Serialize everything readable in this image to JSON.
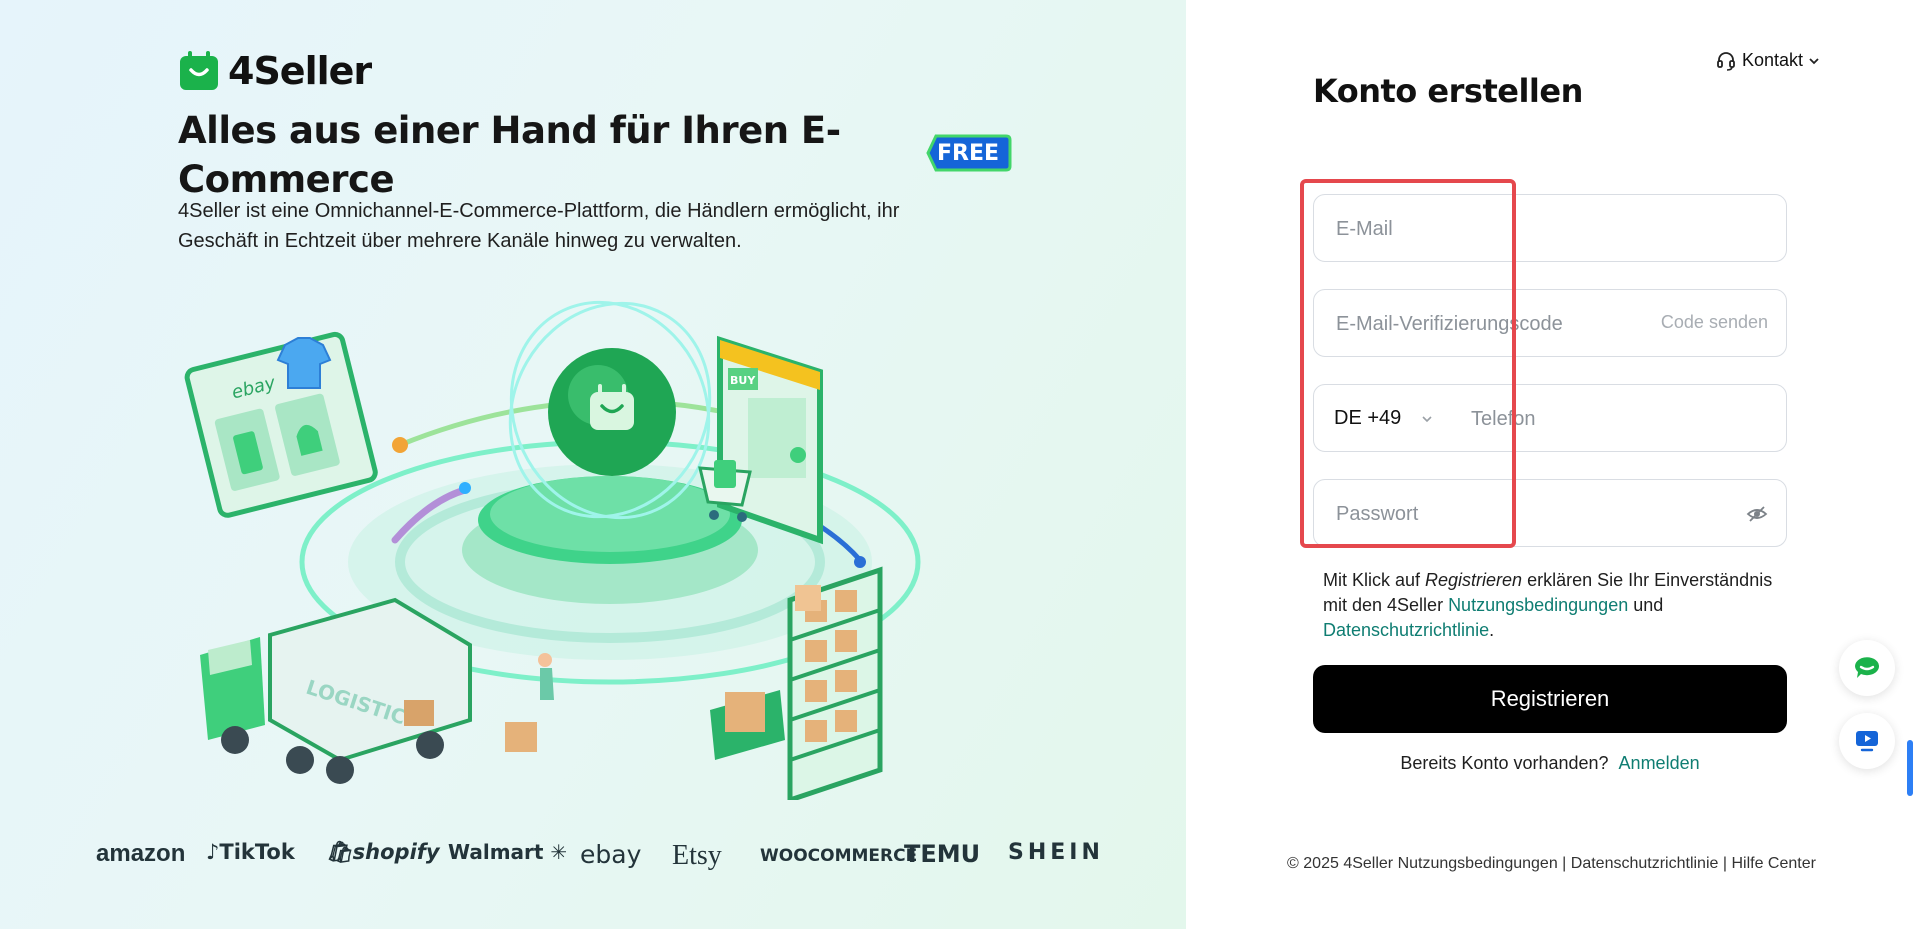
{
  "brand": {
    "name": "4Seller"
  },
  "hero": {
    "headline": "Alles aus einer Hand für Ihren E-Commerce",
    "badge": "FREE",
    "subtitle": "4Seller ist eine Omnichannel-E-Commerce-Plattform, die Händlern ermöglicht, ihr Geschäft in Echtzeit über mehrere Kanäle hinweg zu verwalten.",
    "illustration_text": [
      "ebay",
      "BUY",
      "LOGISTIC"
    ]
  },
  "marketplaces": [
    "amazon",
    "TikTok",
    "shopify",
    "Walmart",
    "ebay",
    "Etsy",
    "WOOCOMMERCE",
    "TEMU",
    "SHEIN"
  ],
  "header": {
    "contact_label": "Kontakt"
  },
  "form": {
    "title": "Konto erstellen",
    "email_placeholder": "E-Mail",
    "code_placeholder": "E-Mail-Verifizierungscode",
    "send_code_label": "Code senden",
    "country_code": "DE +49",
    "phone_placeholder": "Telefon",
    "password_placeholder": "Passwort",
    "terms_prefix": "Mit Klick auf ",
    "terms_action": "Registrieren",
    "terms_mid": " erklären Sie Ihr Einverständnis mit den 4Seller ",
    "terms_link": "Nutzungsbedingungen",
    "terms_and": " und ",
    "privacy_link": "Datenschutzrichtlinie",
    "terms_end": ".",
    "submit_label": "Registrieren",
    "have_account": "Bereits Konto vorhanden?",
    "login_link": "Anmelden"
  },
  "footer": {
    "copyright": "© 2025 4Seller",
    "terms": "Nutzungsbedingungen",
    "privacy": "Datenschutzrichtlinie",
    "help": "Hilfe Center",
    "separator": "|"
  },
  "colors": {
    "accent": "#0f7d72",
    "brand_green": "#1bb24b",
    "annotation": "#e5484d",
    "button": "#000000"
  },
  "icons": {
    "contact": "headset-icon",
    "chat": "chat-icon",
    "video": "video-icon",
    "password_toggle": "eye-off-icon",
    "dropdown": "chevron-down-icon"
  }
}
